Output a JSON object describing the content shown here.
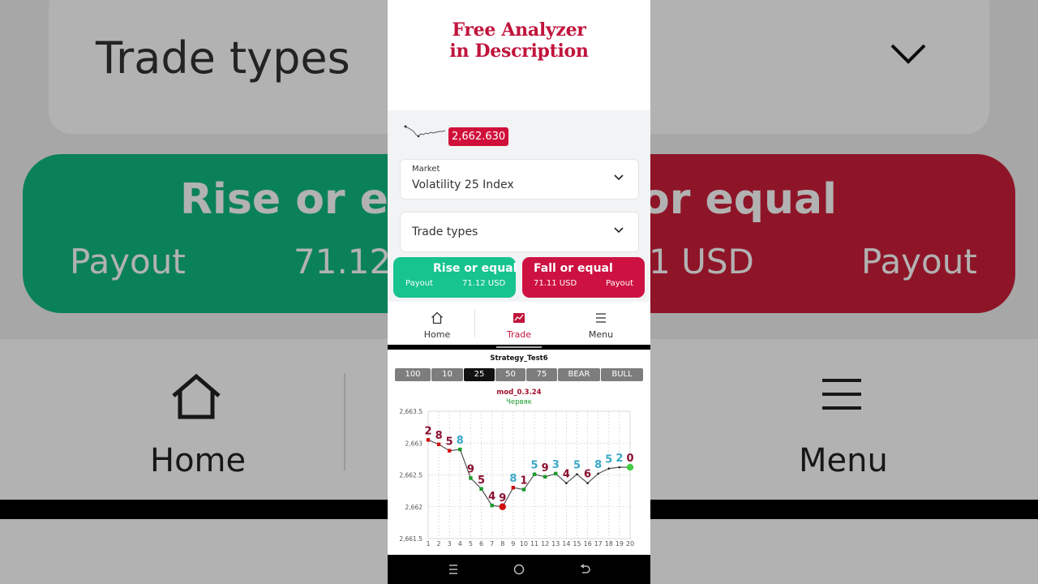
{
  "background": {
    "trade_types_label": "Trade types",
    "rise_title": "Rise or equal",
    "rise_payout_label": "Payout",
    "rise_amount": "71.12",
    "fall_title": "or equal",
    "fall_amount": "1 USD",
    "fall_payout_label": "Payout",
    "nav_home_label": "Home",
    "nav_menu_label": "Menu"
  },
  "promo": {
    "line1": "Free Analyzer",
    "line2": "in Description",
    "color": "#c0143c"
  },
  "ticker": {
    "price": "2,662.630",
    "badge_color": "#d0103a"
  },
  "market": {
    "label": "Market",
    "value": "Volatility 25 Index",
    "icon": "chevron-down-icon"
  },
  "trade_types": {
    "value": "Trade types",
    "icon": "chevron-down-icon"
  },
  "buttons": {
    "rise": {
      "title": "Rise or equal",
      "payout_label": "Payout",
      "amount": "71.12 USD",
      "color": "#17c38e"
    },
    "fall": {
      "title": "Fall or equal",
      "amount": "71.11 USD",
      "payout_label": "Payout",
      "color": "#cd1242"
    }
  },
  "tabs": [
    {
      "label": "Home",
      "icon": "home-icon"
    },
    {
      "label": "Trade",
      "icon": "chart-icon",
      "active": true
    },
    {
      "label": "Menu",
      "icon": "menu-icon"
    }
  ],
  "strategy": {
    "title": "Strategy_Test6",
    "segments": [
      "100",
      "10",
      "25",
      "50",
      "75",
      "BEAR",
      "BULL"
    ],
    "active_segment": "25",
    "mod_label": "mod_0.3.24",
    "worm_label": "Червяк"
  },
  "chart_data": {
    "type": "line",
    "x": [
      1,
      2,
      3,
      4,
      5,
      6,
      7,
      8,
      9,
      10,
      11,
      12,
      13,
      14,
      15,
      16,
      17,
      18,
      19,
      20
    ],
    "values": [
      2663.05,
      2662.98,
      2662.88,
      2662.9,
      2662.45,
      2662.28,
      2662.02,
      2662.0,
      2662.3,
      2662.27,
      2662.51,
      2662.47,
      2662.52,
      2662.37,
      2662.51,
      2662.37,
      2662.52,
      2662.6,
      2662.62,
      2662.62
    ],
    "digits": [
      "2",
      "8",
      "5",
      "8",
      "9",
      "5",
      "4",
      "9",
      "8",
      "1",
      "5",
      "9",
      "3",
      "4",
      "5",
      "6",
      "8",
      "5",
      "2",
      "0"
    ],
    "digit_colors": [
      "#8a1030",
      "#8a1030",
      "#8a1030",
      "#3aa8c8",
      "#8a1030",
      "#8a1030",
      "#8a1030",
      "#8a1030",
      "#3aa8c8",
      "#8a1030",
      "#3aa8c8",
      "#8a1030",
      "#3aa8c8",
      "#8a1030",
      "#3aa8c8",
      "#8a1030",
      "#3aa8c8",
      "#3aa8c8",
      "#3aa8c8",
      "#8a1030"
    ],
    "marker_colors": [
      "#d01010",
      "#d01010",
      "#d01010",
      "#1a9a2a",
      "#1a9a2a",
      "#1a9a2a",
      "#1a9a2a",
      "#d01010",
      "#d01010",
      "#1a9a2a",
      "#1a9a2a",
      "#1a9a2a",
      "#1a9a2a",
      "#222222",
      "#222222",
      "#222222",
      "#222222",
      "#222222",
      "#222222",
      "#44cc44"
    ],
    "y_ticks": [
      "2,663.5",
      "2,663",
      "2,662.5",
      "2,662",
      "2,661.5"
    ],
    "y_tick_values": [
      2663.5,
      2663,
      2662.5,
      2662,
      2661.5
    ],
    "ylim": [
      2661.5,
      2663.5
    ],
    "xlim": [
      1,
      20
    ],
    "grid": true
  }
}
